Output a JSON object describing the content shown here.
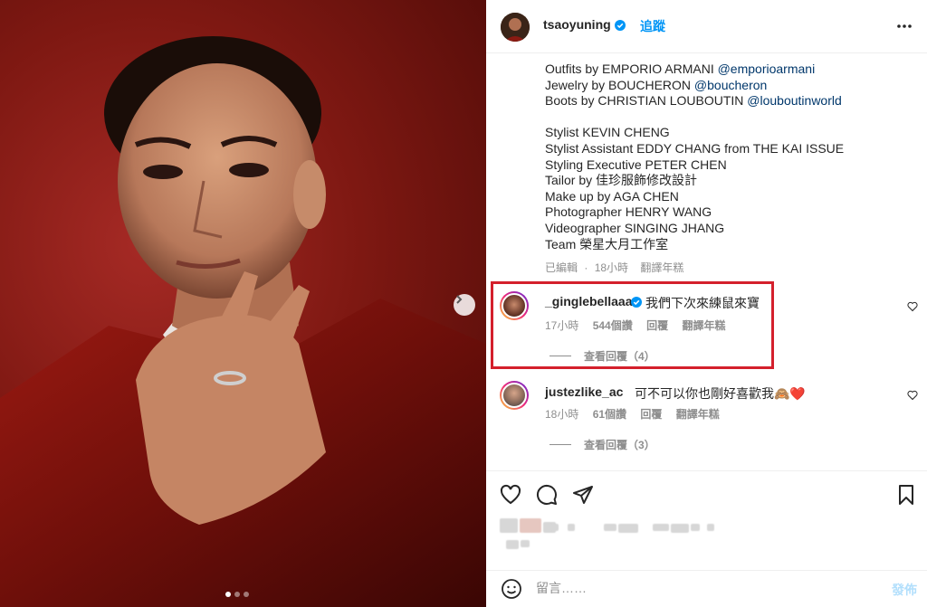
{
  "post": {
    "author": "tsaoyuning",
    "follow_label": "追蹤",
    "carousel": {
      "total": 3,
      "active": 1
    }
  },
  "caption": {
    "lines": [
      {
        "text": "Outfits by EMPORIO ARMANI ",
        "tag": "@emporioarmani"
      },
      {
        "text": "Jewelry by BOUCHERON ",
        "tag": "@boucheron"
      },
      {
        "text": "Boots by CHRISTIAN LOUBOUTIN ",
        "tag": "@louboutinworld"
      }
    ],
    "credits": [
      "Stylist KEVIN CHENG",
      "Stylist Assistant EDDY CHANG from THE KAI ISSUE",
      "Styling Executive PETER CHEN",
      "Tailor by 佳珍服飾修改設計",
      "Make up by AGA CHEN",
      "Photographer HENRY WANG",
      "Videographer SINGING JHANG",
      "Team 榮星大月工作室"
    ],
    "edited": "已編輯",
    "time": "18小時",
    "translate": "翻譯年糕"
  },
  "comments": [
    {
      "user": "_ginglebellaaa",
      "text": "我們下次來練鼠來寶",
      "time": "17小時",
      "likes": "544個讚",
      "reply": "回覆",
      "translate": "翻譯年糕",
      "view_replies": "查看回覆（4）"
    },
    {
      "user": "justezlike_ac",
      "text": "可不可以你也剛好喜歡我🙈❤️",
      "time": "18小時",
      "likes": "61個讚",
      "reply": "回覆",
      "translate": "翻譯年糕",
      "view_replies": "查看回覆（3）"
    }
  ],
  "add_comment": {
    "placeholder": "留言……",
    "post_label": "發佈"
  },
  "colors": {
    "link": "#00376b",
    "follow": "#0095f6",
    "verified": "#0095f6",
    "highlight": "#d4202c",
    "heart": "#ed4956"
  },
  "icons": {
    "verified": "verified-badge-icon",
    "more": "more-options-icon",
    "like": "heart-icon",
    "comment": "comment-icon",
    "share": "share-icon",
    "save": "bookmark-icon",
    "emoji": "emoji-icon",
    "next": "chevron-right-icon"
  }
}
